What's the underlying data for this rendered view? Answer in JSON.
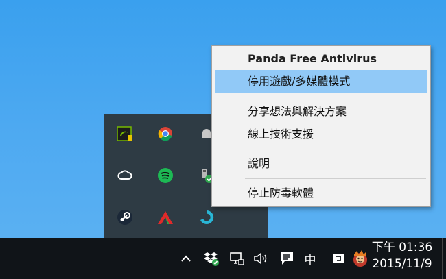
{
  "context_menu": {
    "title": "Panda Free Antivirus",
    "items": [
      {
        "label": "停用遊戲/多媒體模式",
        "highlighted": true
      },
      {
        "label": "分享想法與解決方案"
      },
      {
        "label": "線上技術支援"
      },
      {
        "label": "說明"
      },
      {
        "label": "停止防毒軟體"
      }
    ]
  },
  "tray_overflow": {
    "icons": [
      "nvidia-icon",
      "chrome-icon",
      "bell-icon",
      "creative-cloud-icon",
      "spotify-icon",
      "safely-remove-hardware-icon",
      "steam-icon",
      "arrow-app-icon",
      "panda-antivirus-icon"
    ]
  },
  "taskbar": {
    "input_language": "中",
    "clock_time": "下午 01:36",
    "clock_date": "2015/11/9"
  },
  "colors": {
    "desktop": "#4da9f1",
    "taskbar": "#101418",
    "highlight": "#91c9f7",
    "tray_panel": "#2e3b44"
  }
}
